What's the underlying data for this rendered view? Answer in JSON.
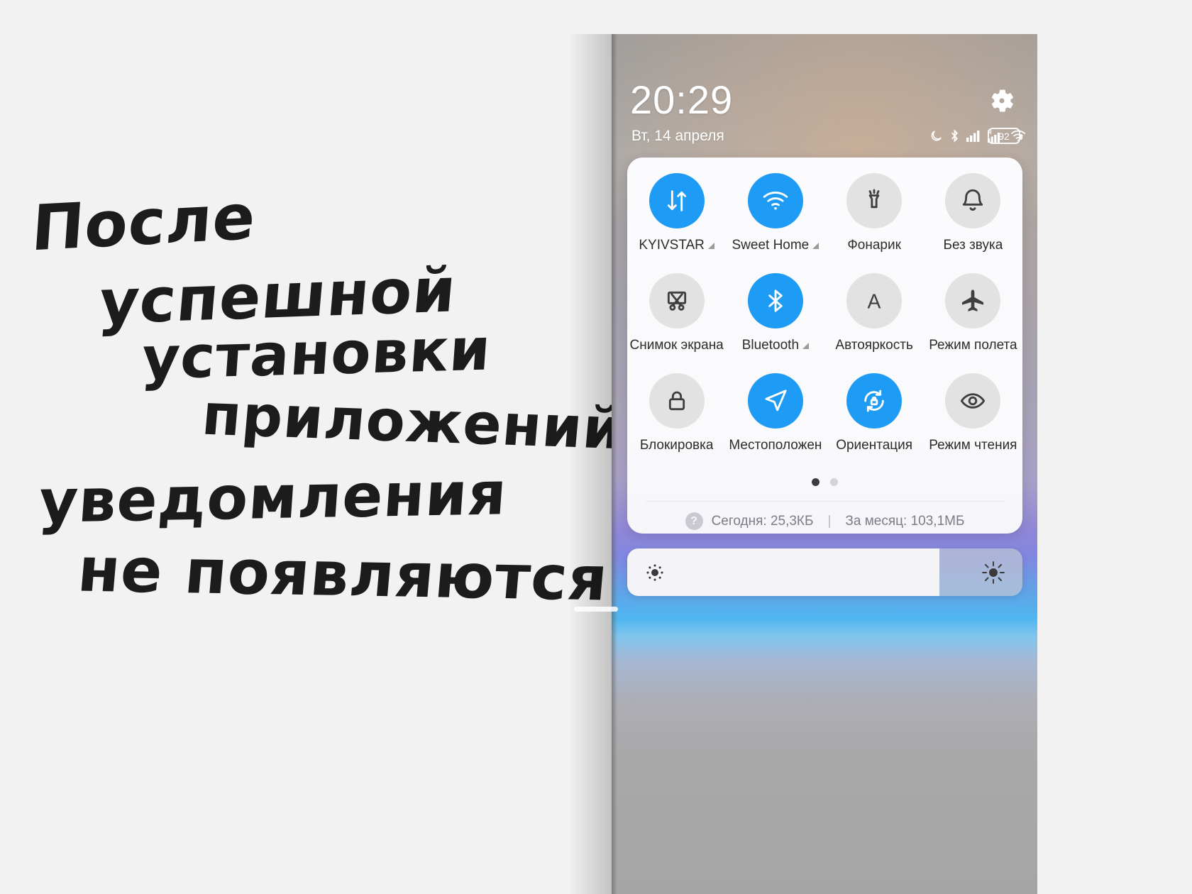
{
  "note": {
    "lines": [
      "После",
      "успешной",
      "установки",
      "приложений",
      "уведомления",
      "не появляются"
    ],
    "full_text": "После успешной установки приложений уведомления не появляются"
  },
  "status": {
    "time": "20:29",
    "date": "Вт, 14 апреля",
    "battery_percent": "92",
    "gear_icon": "gear-icon",
    "icons": [
      "moon-do-not-disturb-icon",
      "bluetooth-icon",
      "signal-bars-icon",
      "signal-roaming-icon",
      "wifi-icon",
      "battery-icon"
    ]
  },
  "quick_settings": {
    "tiles": [
      {
        "label": "KYIVSTAR",
        "icon": "mobile-data-icon",
        "active": true,
        "has_caret": true
      },
      {
        "label": "Sweet Home",
        "icon": "wifi-icon",
        "active": true,
        "has_caret": true
      },
      {
        "label": "Фонарик",
        "icon": "flashlight-icon",
        "active": false,
        "has_caret": false
      },
      {
        "label": "Без звука",
        "icon": "bell-icon",
        "active": false,
        "has_caret": false
      },
      {
        "label": "Снимок экрана",
        "icon": "screenshot-icon",
        "active": false,
        "has_caret": false
      },
      {
        "label": "Bluetooth",
        "icon": "bluetooth-icon",
        "active": true,
        "has_caret": true
      },
      {
        "label": "Автояркость",
        "icon": "auto-brightness-icon",
        "active": false,
        "has_caret": false
      },
      {
        "label": "Режим полета",
        "icon": "airplane-icon",
        "active": false,
        "has_caret": false
      },
      {
        "label": "Блокировка",
        "icon": "lock-icon",
        "active": false,
        "has_caret": false
      },
      {
        "label": "Местоположен",
        "icon": "location-arrow-icon",
        "active": true,
        "has_caret": false
      },
      {
        "label": "Ориентация",
        "icon": "rotation-lock-icon",
        "active": true,
        "has_caret": false
      },
      {
        "label": "Режим чтения",
        "icon": "eye-icon",
        "active": false,
        "has_caret": false
      }
    ],
    "pages": {
      "count": 2,
      "active_index": 0
    },
    "data_usage": {
      "help_icon": "?",
      "today": "Сегодня: 25,3КБ",
      "separator": "|",
      "month": "За месяц: 103,1МБ"
    }
  },
  "brightness": {
    "level_percent": 79,
    "low_icon": "brightness-low-icon",
    "high_icon": "brightness-high-icon"
  },
  "colors": {
    "accent_blue": "#1e9cf5",
    "tile_off": "#e2e2e2",
    "card_bg": "#fbfbfd",
    "label_text": "#2c2c2c",
    "muted_text": "#7c7c86"
  }
}
